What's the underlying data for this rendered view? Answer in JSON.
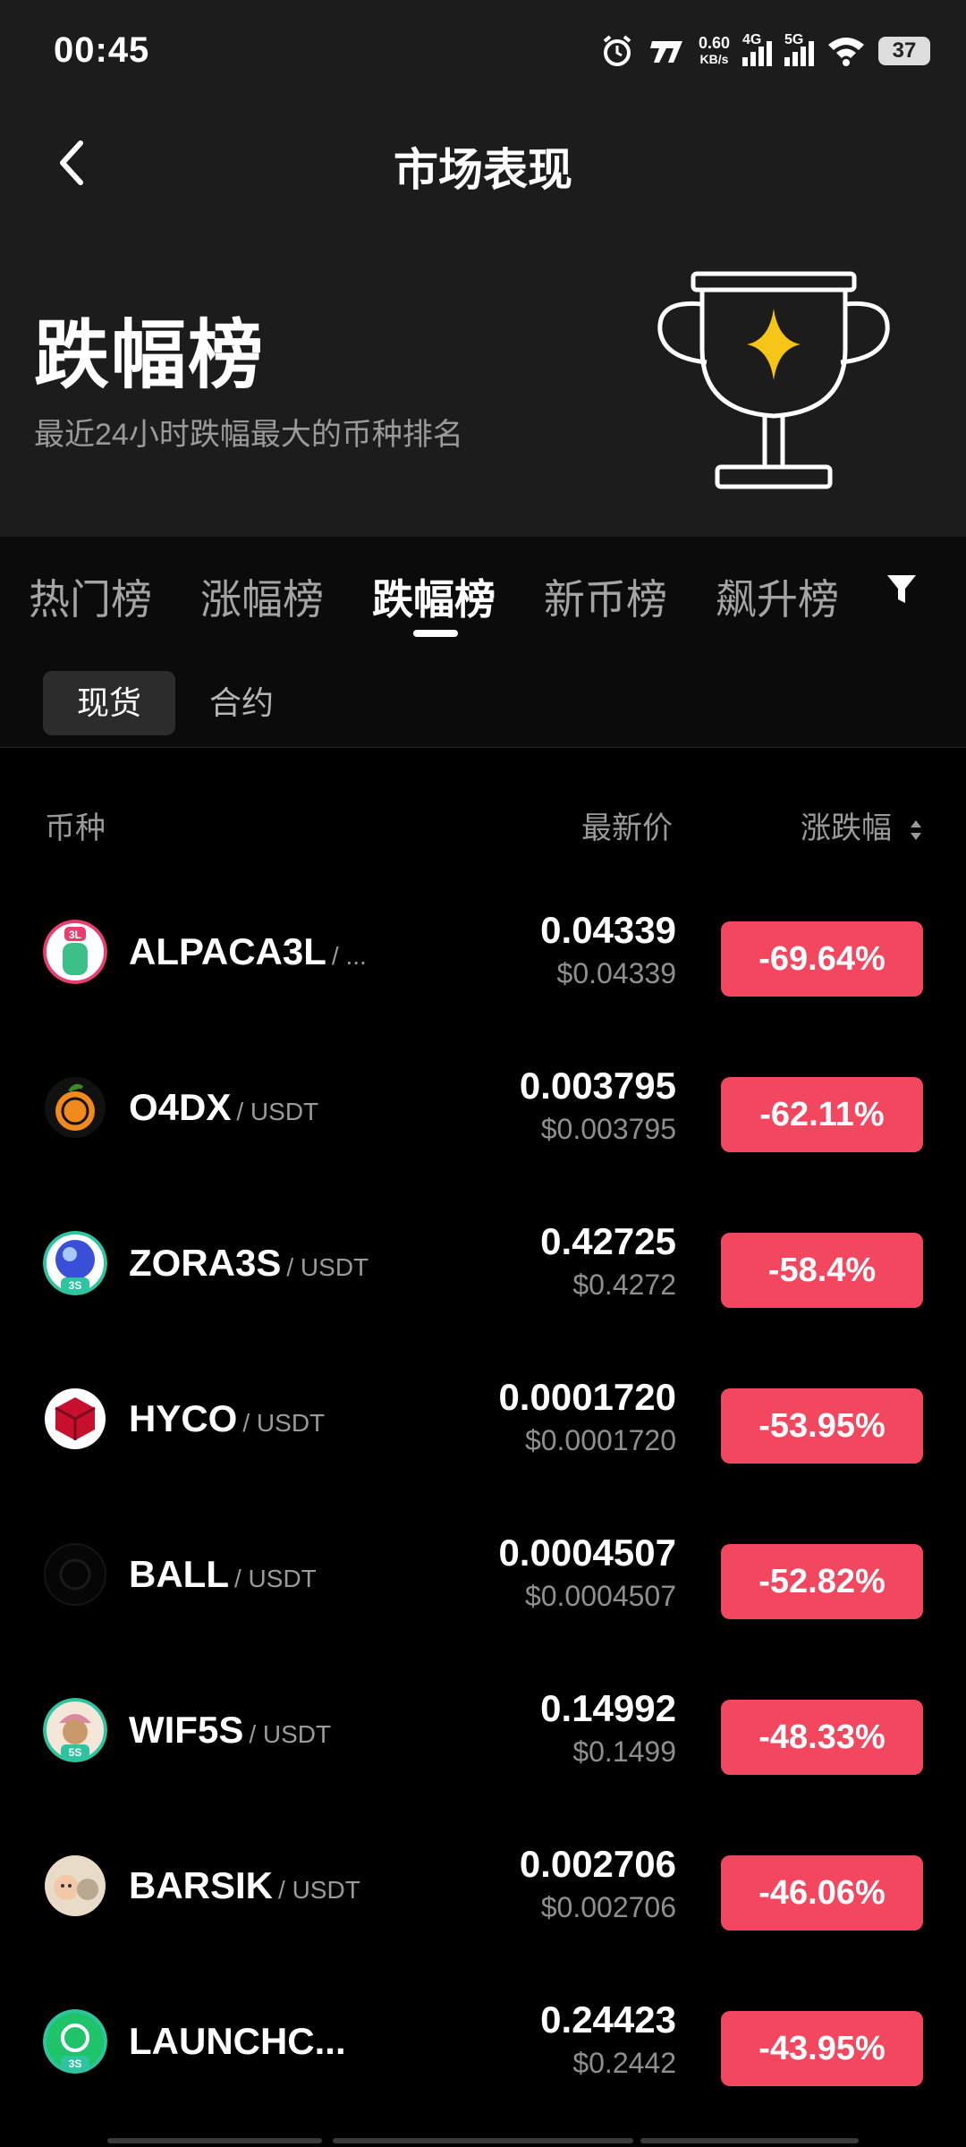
{
  "status_bar": {
    "time": "00:45",
    "speed_value": "0.60",
    "speed_unit": "KB/s",
    "net1": "4G",
    "net2": "5G",
    "battery": "37"
  },
  "header": {
    "title": "市场表现",
    "hero_title": "跌幅榜",
    "hero_subtitle": "最近24小时跌幅最大的币种排名",
    "accent_color": "#f5c518"
  },
  "tabs": [
    {
      "label": "热门榜"
    },
    {
      "label": "涨幅榜"
    },
    {
      "label": "跌幅榜",
      "active": true
    },
    {
      "label": "新币榜"
    },
    {
      "label": "飙升榜"
    }
  ],
  "subtabs": [
    {
      "label": "现货",
      "active": true
    },
    {
      "label": "合约"
    }
  ],
  "columns": {
    "coin": "币种",
    "price": "最新价",
    "change": "涨跌幅"
  },
  "rows": [
    {
      "name": "ALPACA3L",
      "pair": "/ ...",
      "price": "0.04339",
      "price_usd": "$0.04339",
      "change": "-69.64%",
      "icon": "alpaca-3l-icon"
    },
    {
      "name": "O4DX",
      "pair": "/ USDT",
      "price": "0.003795",
      "price_usd": "$0.003795",
      "change": "-62.11%",
      "icon": "orange-coin-icon"
    },
    {
      "name": "ZORA3S",
      "pair": "/ USDT",
      "price": "0.42725",
      "price_usd": "$0.4272",
      "change": "-58.4%",
      "icon": "zora-3s-icon"
    },
    {
      "name": "HYCO",
      "pair": "/ USDT",
      "price": "0.0001720",
      "price_usd": "$0.0001720",
      "change": "-53.95%",
      "icon": "red-cube-icon"
    },
    {
      "name": "BALL",
      "pair": "/ USDT",
      "price": "0.0004507",
      "price_usd": "$0.0004507",
      "change": "-52.82%",
      "icon": "ball-icon"
    },
    {
      "name": "WIF5S",
      "pair": "/ USDT",
      "price": "0.14992",
      "price_usd": "$0.1499",
      "change": "-48.33%",
      "icon": "wif-5s-icon"
    },
    {
      "name": "BARSIK",
      "pair": "/ USDT",
      "price": "0.002706",
      "price_usd": "$0.002706",
      "change": "-46.06%",
      "icon": "barsik-icon"
    },
    {
      "name": "LAUNCHC...",
      "pair": "",
      "price": "0.24423",
      "price_usd": "$0.2442",
      "change": "-43.95%",
      "icon": "launchcoin-3s-icon"
    }
  ],
  "colors": {
    "negative": "#f2475e",
    "background": "#000000",
    "header_bg": "#1c1c1c"
  }
}
